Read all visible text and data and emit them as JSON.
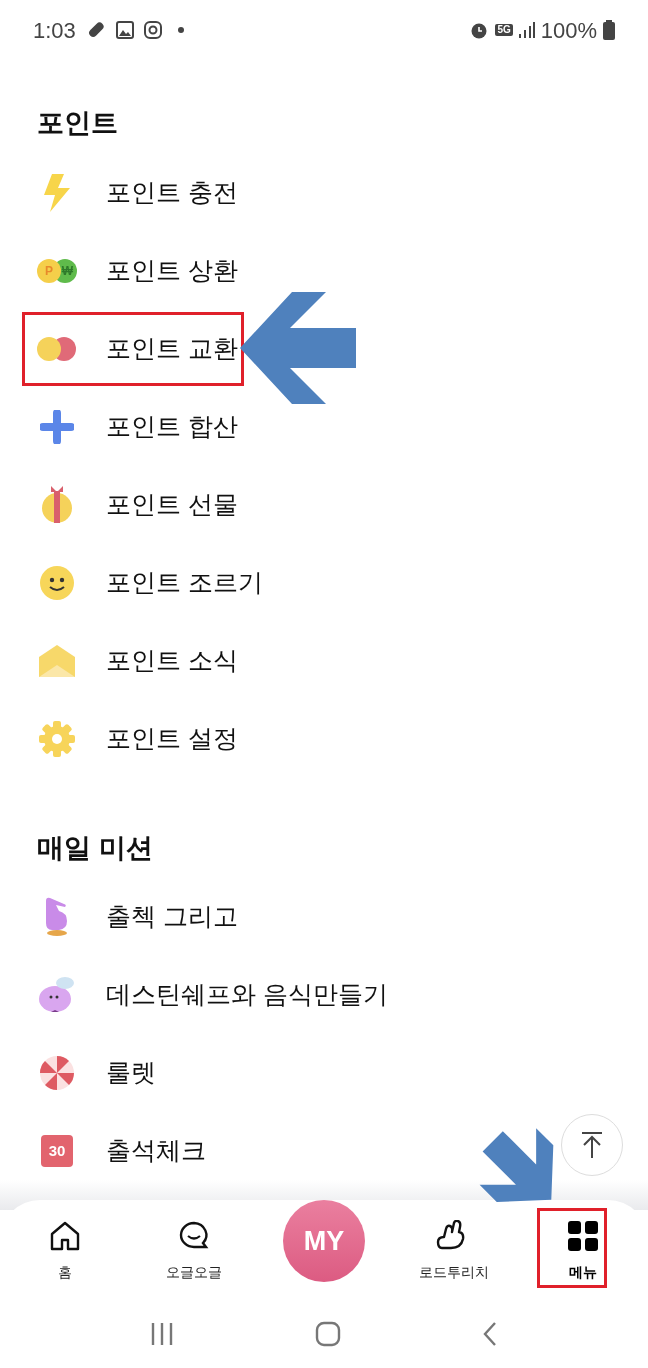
{
  "status_bar": {
    "time": "1:03",
    "network": "5G",
    "battery": "100%"
  },
  "sections": [
    {
      "title": "포인트",
      "items": [
        {
          "label": "포인트 충전",
          "kind": "bolt",
          "highlighted": false
        },
        {
          "label": "포인트 상환",
          "kind": "coins",
          "highlighted": false,
          "icon_letters": [
            "P",
            "₩"
          ]
        },
        {
          "label": "포인트 교환",
          "kind": "exchange",
          "highlighted": true
        },
        {
          "label": "포인트 합산",
          "kind": "plus",
          "highlighted": false
        },
        {
          "label": "포인트 선물",
          "kind": "gift",
          "highlighted": false
        },
        {
          "label": "포인트 조르기",
          "kind": "smile",
          "highlighted": false
        },
        {
          "label": "포인트 소식",
          "kind": "mail",
          "highlighted": false
        },
        {
          "label": "포인트 설정",
          "kind": "gear",
          "highlighted": false
        }
      ]
    },
    {
      "title": "매일 미션",
      "items": [
        {
          "label": "출첵 그리고",
          "kind": "finger",
          "highlighted": false
        },
        {
          "label": "데스틴쉐프와 음식만들기",
          "kind": "chef",
          "highlighted": false
        },
        {
          "label": "룰렛",
          "kind": "roulette",
          "highlighted": false
        },
        {
          "label": "출석체크",
          "kind": "calendar",
          "highlighted": false,
          "icon_text": "30"
        }
      ]
    }
  ],
  "bottom_nav": [
    {
      "label": "홈",
      "kind": "home",
      "selected": false,
      "highlighted": false
    },
    {
      "label": "오글오글",
      "kind": "chat",
      "selected": false,
      "highlighted": false
    },
    {
      "label": "MY",
      "kind": "profile",
      "selected": false
    },
    {
      "label": "로드투리치",
      "kind": "hand",
      "selected": false,
      "highlighted": false
    },
    {
      "label": "메뉴",
      "kind": "menu",
      "selected": true,
      "highlighted": true
    }
  ]
}
